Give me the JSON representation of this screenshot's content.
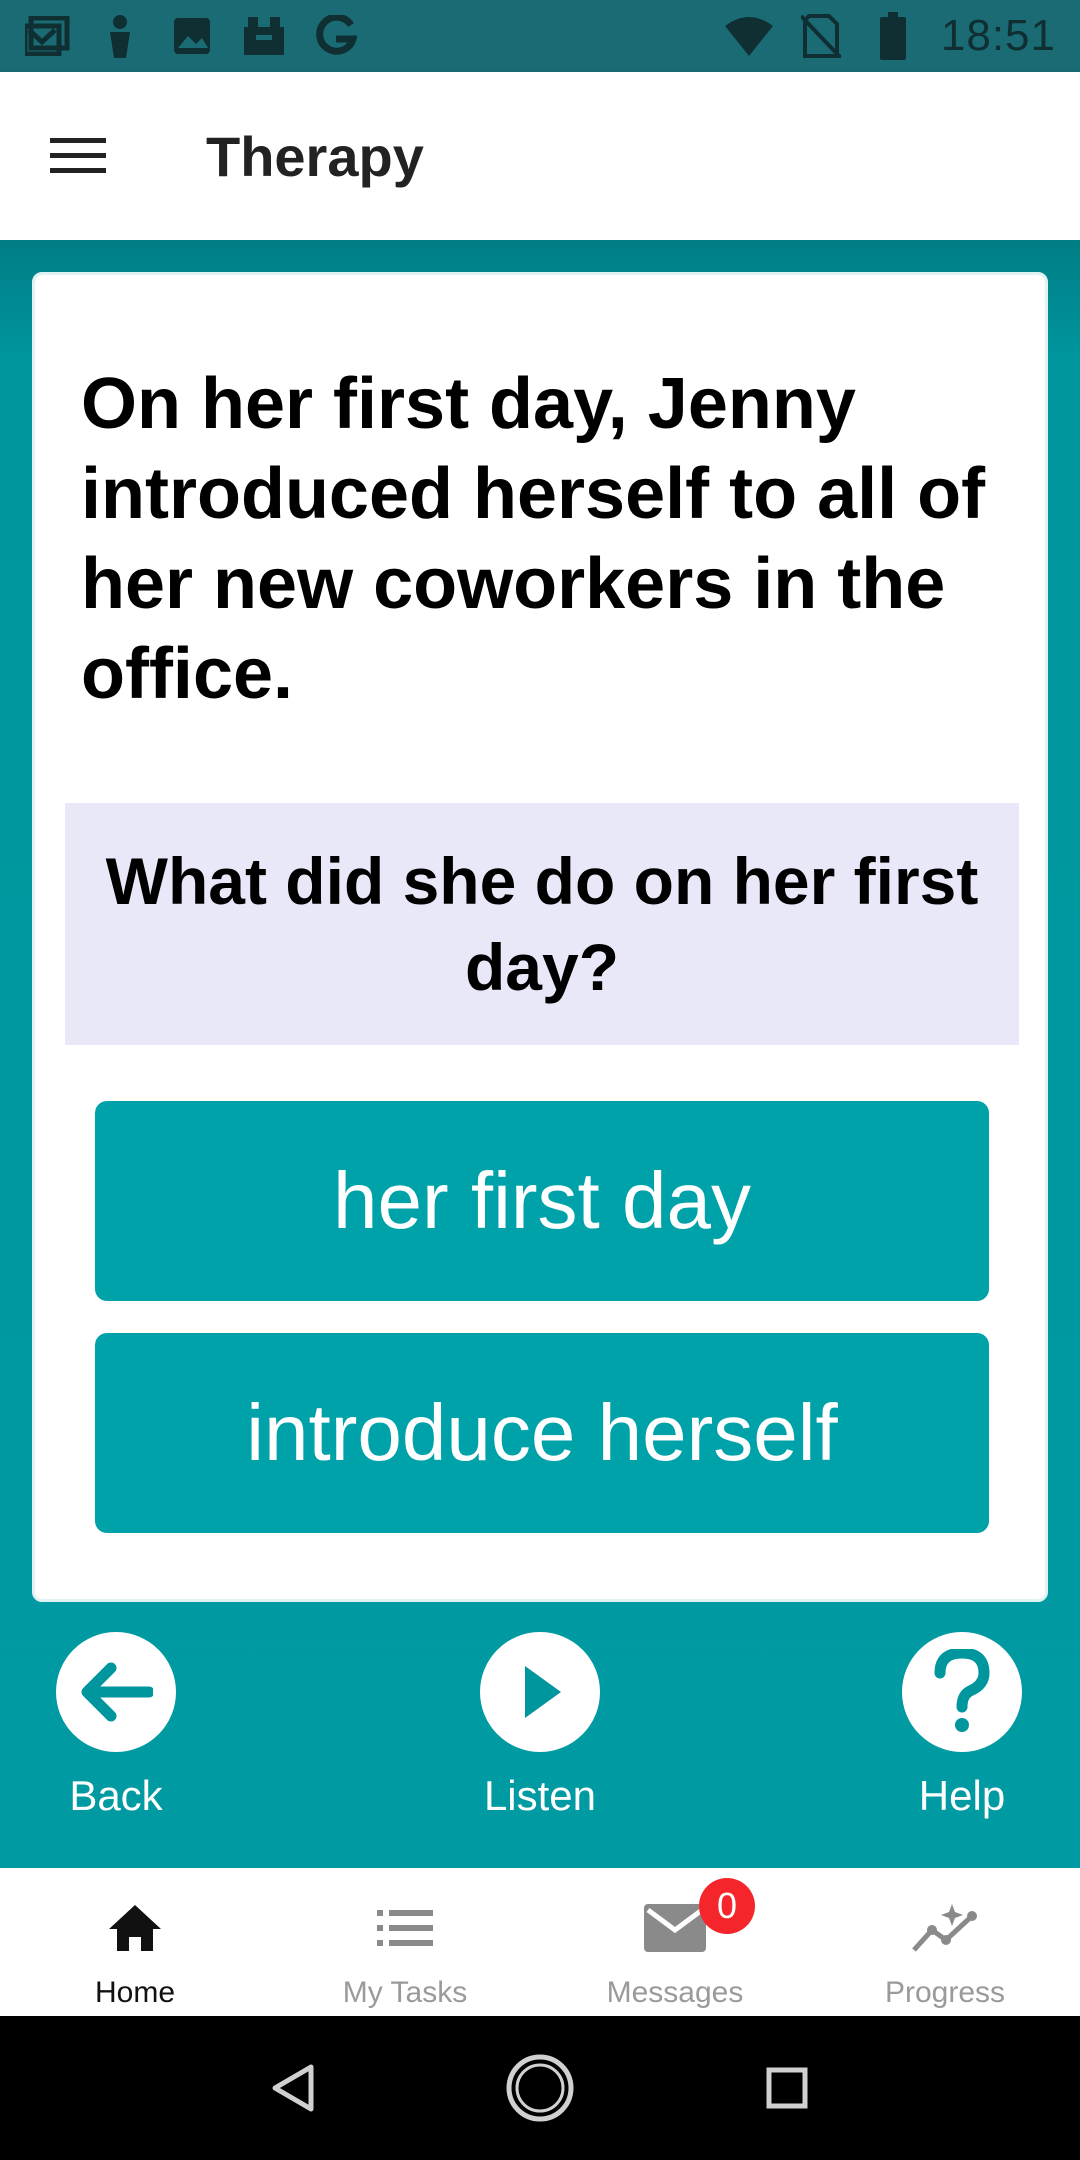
{
  "status_bar": {
    "time": "18:51",
    "left_icons": [
      "inbox-icon",
      "person-icon",
      "image-icon",
      "box-icon",
      "google-icon"
    ],
    "right_icons": [
      "wifi-icon",
      "no-sim-icon",
      "battery-icon"
    ]
  },
  "app_bar": {
    "menu_icon": "hamburger-menu-icon",
    "title": "Therapy"
  },
  "exercise": {
    "passage": "On her first day, Jenny introduced herself to all of her new coworkers in the office.",
    "question": "What did she do on her first day?",
    "answers": [
      {
        "label": "her first day"
      },
      {
        "label": "introduce herself"
      }
    ]
  },
  "controls": {
    "back_label": "Back",
    "listen_label": "Listen",
    "help_label": "Help"
  },
  "bottom_nav": {
    "items": [
      {
        "label": "Home",
        "icon": "home-icon",
        "active": true
      },
      {
        "label": "My Tasks",
        "icon": "list-icon",
        "active": false
      },
      {
        "label": "Messages",
        "icon": "mail-icon",
        "active": false,
        "badge": "0"
      },
      {
        "label": "Progress",
        "icon": "progress-chart-icon",
        "active": false
      }
    ]
  },
  "colors": {
    "teal": "#009aa2",
    "button_teal": "#00a2aa",
    "question_bg": "#e8e8f8",
    "badge_red": "#f4262b"
  }
}
